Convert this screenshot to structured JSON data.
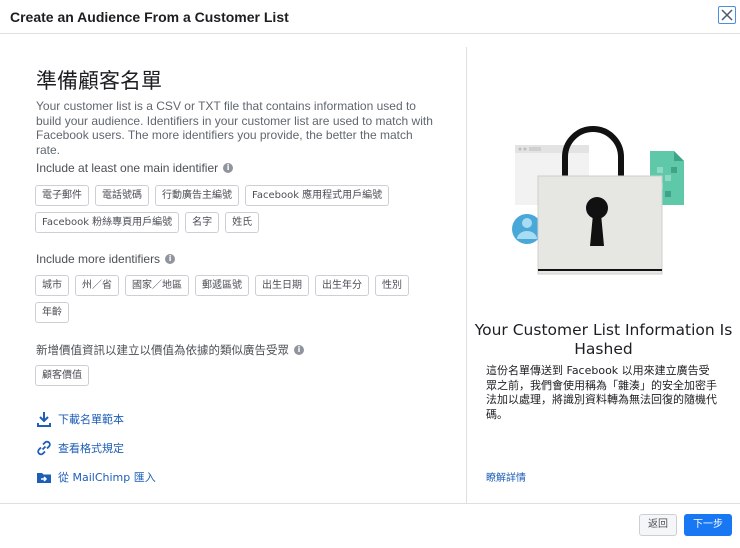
{
  "header": {
    "title": "Create an Audience From a Customer List"
  },
  "left": {
    "heading": "準備顧客名單",
    "intro": "Your customer list is a CSV or TXT file that contains information used to build your audience. Identifiers in your customer list are used to match with Facebook users. The more identifiers you provide, the better the match rate.",
    "main_label": "Include at least one main identifier",
    "main_identifiers": [
      "電子郵件",
      "電話號碼",
      "行動廣告主編號",
      "Facebook 應用程式用戶編號",
      "Facebook 粉絲專頁用戶編號",
      "名字",
      "姓氏"
    ],
    "more_label": "Include more identifiers",
    "more_identifiers": [
      "城市",
      "州／省",
      "國家／地區",
      "郵遞區號",
      "出生日期",
      "出生年分",
      "性別",
      "年齡"
    ],
    "value_label": "新增價值資訊以建立以價值為依據的類似廣告受眾",
    "value_identifiers": [
      "顧客價值"
    ],
    "links": {
      "download": "下載名單範本",
      "format": "查看格式規定",
      "mailchimp": "從 MailChimp 匯入"
    }
  },
  "right": {
    "title": "Your Customer List Information Is Hashed",
    "desc": "這份名單傳送到 Facebook 以用來建立廣告受眾之前，我們會使用稱為「雜湊」的安全加密手法加以處理，將識別資料轉為無法回復的隨機代碼。",
    "learn_more": "瞭解詳情"
  },
  "footer": {
    "back": "返回",
    "next": "下一步"
  },
  "colors": {
    "accent": "#1877f2",
    "link": "#1d5eb8",
    "teal": "#5fc8a8"
  }
}
